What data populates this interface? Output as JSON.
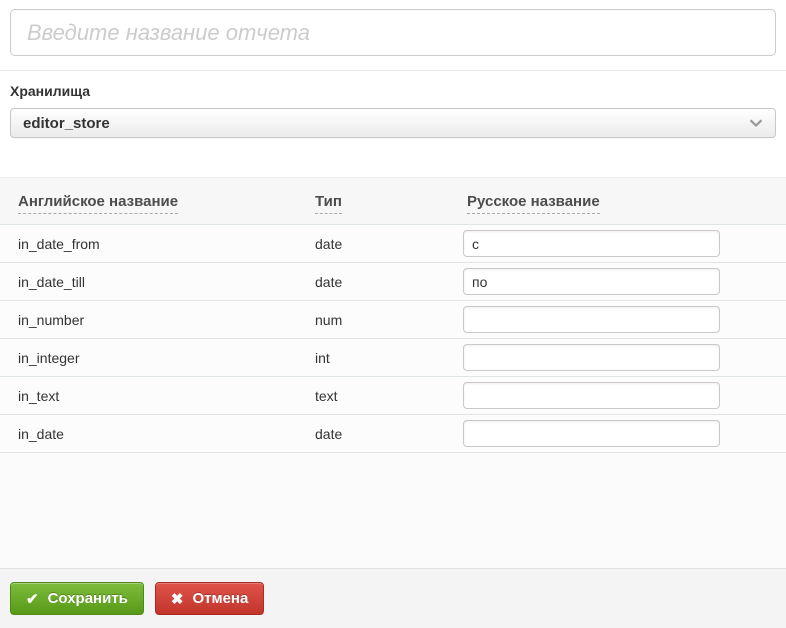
{
  "report_name": {
    "placeholder": "Введите название отчета",
    "value": ""
  },
  "storages": {
    "label": "Хранилища",
    "selected_option": "editor_store"
  },
  "table": {
    "columns": {
      "english_name": "Английское название",
      "type": "Тип",
      "russian_name": "Русское название"
    },
    "rows": [
      {
        "en_name": "in_date_from",
        "type": "date",
        "ru_name": "с"
      },
      {
        "en_name": "in_date_till",
        "type": "date",
        "ru_name": "по"
      },
      {
        "en_name": "in_number",
        "type": "num",
        "ru_name": ""
      },
      {
        "en_name": "in_integer",
        "type": "int",
        "ru_name": ""
      },
      {
        "en_name": "in_text",
        "type": "text",
        "ru_name": ""
      },
      {
        "en_name": "in_date",
        "type": "date",
        "ru_name": ""
      }
    ]
  },
  "footer": {
    "save_label": "Сохранить",
    "save_icon": "✔",
    "cancel_label": "Отмена",
    "cancel_icon": "✖"
  },
  "colors": {
    "save_green_top": "#7ebc3b",
    "save_green_bottom": "#579a18",
    "cancel_red_top": "#e0544b",
    "cancel_red_bottom": "#c1352b",
    "row_border": "#dfe5e7",
    "header_bg": "#f7f7f7",
    "placeholder_gray": "#cccccc"
  }
}
